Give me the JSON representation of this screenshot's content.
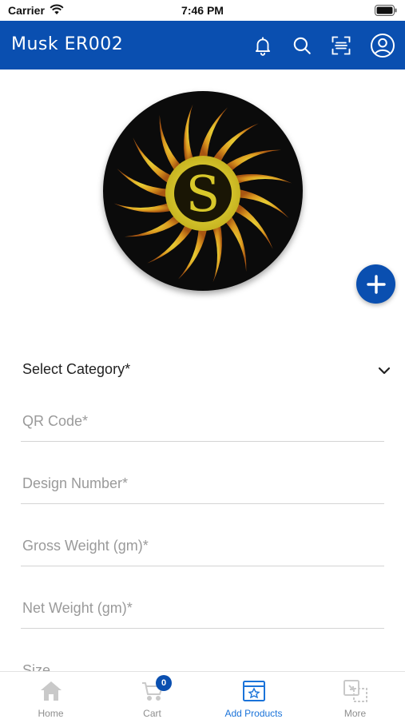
{
  "status_bar": {
    "carrier": "Carrier",
    "time": "7:46 PM"
  },
  "app_bar": {
    "title": "Musk ER002",
    "icons": [
      "bell-icon",
      "search-icon",
      "scan-icon",
      "profile-icon"
    ],
    "background_color": "#0a4fb0"
  },
  "logo": {
    "letter": "S",
    "colors": {
      "background": "#0b0b0b",
      "ring": "#d9cf2a",
      "rays": "#e39a1f"
    }
  },
  "fab": {
    "icon": "plus-icon",
    "color": "#0a4fb0"
  },
  "form": {
    "category": {
      "label": "Select Category*",
      "icon": "chevron-down-icon"
    },
    "fields": [
      {
        "placeholder": "QR Code*",
        "value": ""
      },
      {
        "placeholder": "Design Number*",
        "value": ""
      },
      {
        "placeholder": "Gross Weight (gm)*",
        "value": ""
      },
      {
        "placeholder": "Net Weight (gm)*",
        "value": ""
      },
      {
        "placeholder": "Size",
        "value": ""
      }
    ]
  },
  "bottom_nav": {
    "items": [
      {
        "label": "Home",
        "icon": "home-icon",
        "active": false
      },
      {
        "label": "Cart",
        "icon": "cart-icon",
        "active": false,
        "badge": "0"
      },
      {
        "label": "Add Products",
        "icon": "add-products-icon",
        "active": true
      },
      {
        "label": "More",
        "icon": "more-icon",
        "active": false
      }
    ],
    "active_color": "#1a73d9"
  }
}
